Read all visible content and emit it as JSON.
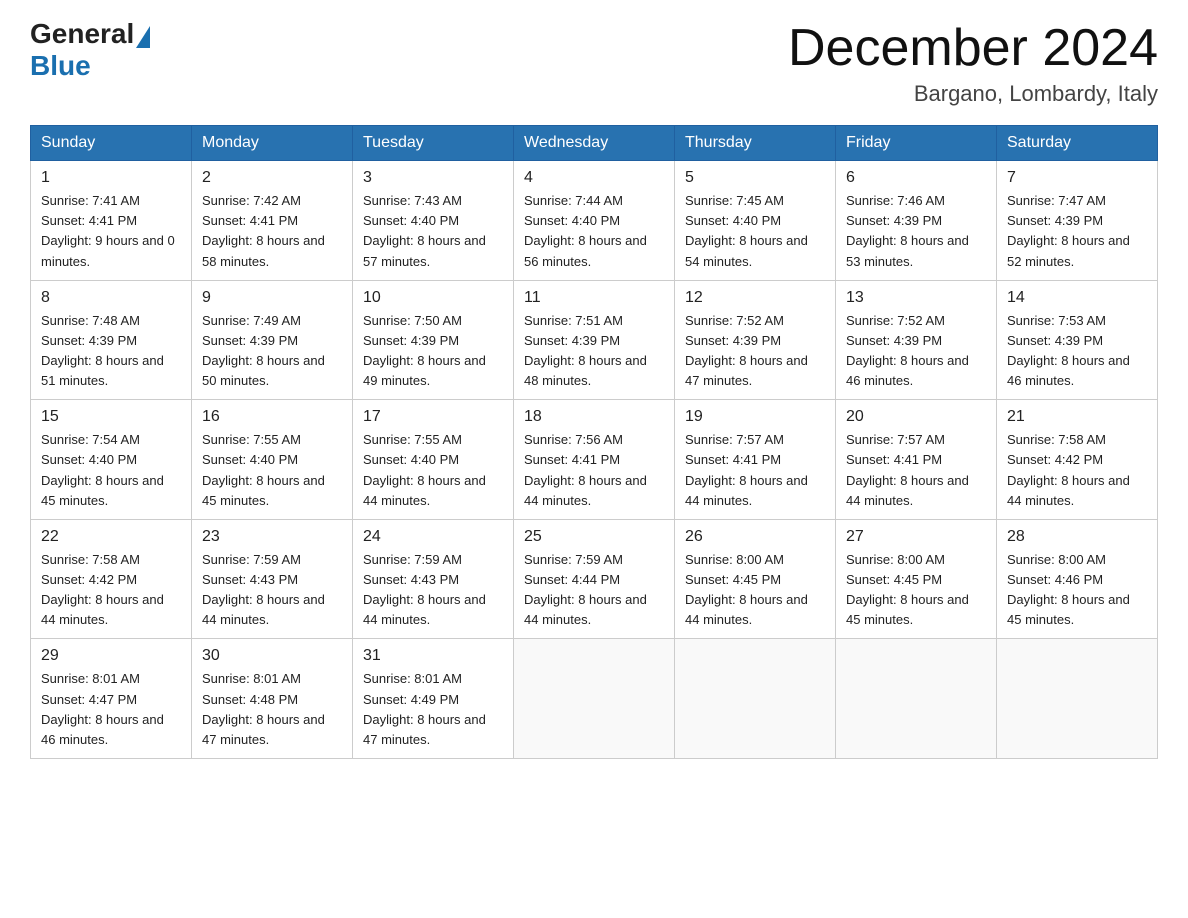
{
  "header": {
    "logo_general": "General",
    "logo_blue": "Blue",
    "month_title": "December 2024",
    "location": "Bargano, Lombardy, Italy"
  },
  "days_of_week": [
    "Sunday",
    "Monday",
    "Tuesday",
    "Wednesday",
    "Thursday",
    "Friday",
    "Saturday"
  ],
  "weeks": [
    [
      {
        "day": "1",
        "sunrise": "7:41 AM",
        "sunset": "4:41 PM",
        "daylight": "9 hours and 0 minutes."
      },
      {
        "day": "2",
        "sunrise": "7:42 AM",
        "sunset": "4:41 PM",
        "daylight": "8 hours and 58 minutes."
      },
      {
        "day": "3",
        "sunrise": "7:43 AM",
        "sunset": "4:40 PM",
        "daylight": "8 hours and 57 minutes."
      },
      {
        "day": "4",
        "sunrise": "7:44 AM",
        "sunset": "4:40 PM",
        "daylight": "8 hours and 56 minutes."
      },
      {
        "day": "5",
        "sunrise": "7:45 AM",
        "sunset": "4:40 PM",
        "daylight": "8 hours and 54 minutes."
      },
      {
        "day": "6",
        "sunrise": "7:46 AM",
        "sunset": "4:39 PM",
        "daylight": "8 hours and 53 minutes."
      },
      {
        "day": "7",
        "sunrise": "7:47 AM",
        "sunset": "4:39 PM",
        "daylight": "8 hours and 52 minutes."
      }
    ],
    [
      {
        "day": "8",
        "sunrise": "7:48 AM",
        "sunset": "4:39 PM",
        "daylight": "8 hours and 51 minutes."
      },
      {
        "day": "9",
        "sunrise": "7:49 AM",
        "sunset": "4:39 PM",
        "daylight": "8 hours and 50 minutes."
      },
      {
        "day": "10",
        "sunrise": "7:50 AM",
        "sunset": "4:39 PM",
        "daylight": "8 hours and 49 minutes."
      },
      {
        "day": "11",
        "sunrise": "7:51 AM",
        "sunset": "4:39 PM",
        "daylight": "8 hours and 48 minutes."
      },
      {
        "day": "12",
        "sunrise": "7:52 AM",
        "sunset": "4:39 PM",
        "daylight": "8 hours and 47 minutes."
      },
      {
        "day": "13",
        "sunrise": "7:52 AM",
        "sunset": "4:39 PM",
        "daylight": "8 hours and 46 minutes."
      },
      {
        "day": "14",
        "sunrise": "7:53 AM",
        "sunset": "4:39 PM",
        "daylight": "8 hours and 46 minutes."
      }
    ],
    [
      {
        "day": "15",
        "sunrise": "7:54 AM",
        "sunset": "4:40 PM",
        "daylight": "8 hours and 45 minutes."
      },
      {
        "day": "16",
        "sunrise": "7:55 AM",
        "sunset": "4:40 PM",
        "daylight": "8 hours and 45 minutes."
      },
      {
        "day": "17",
        "sunrise": "7:55 AM",
        "sunset": "4:40 PM",
        "daylight": "8 hours and 44 minutes."
      },
      {
        "day": "18",
        "sunrise": "7:56 AM",
        "sunset": "4:41 PM",
        "daylight": "8 hours and 44 minutes."
      },
      {
        "day": "19",
        "sunrise": "7:57 AM",
        "sunset": "4:41 PM",
        "daylight": "8 hours and 44 minutes."
      },
      {
        "day": "20",
        "sunrise": "7:57 AM",
        "sunset": "4:41 PM",
        "daylight": "8 hours and 44 minutes."
      },
      {
        "day": "21",
        "sunrise": "7:58 AM",
        "sunset": "4:42 PM",
        "daylight": "8 hours and 44 minutes."
      }
    ],
    [
      {
        "day": "22",
        "sunrise": "7:58 AM",
        "sunset": "4:42 PM",
        "daylight": "8 hours and 44 minutes."
      },
      {
        "day": "23",
        "sunrise": "7:59 AM",
        "sunset": "4:43 PM",
        "daylight": "8 hours and 44 minutes."
      },
      {
        "day": "24",
        "sunrise": "7:59 AM",
        "sunset": "4:43 PM",
        "daylight": "8 hours and 44 minutes."
      },
      {
        "day": "25",
        "sunrise": "7:59 AM",
        "sunset": "4:44 PM",
        "daylight": "8 hours and 44 minutes."
      },
      {
        "day": "26",
        "sunrise": "8:00 AM",
        "sunset": "4:45 PM",
        "daylight": "8 hours and 44 minutes."
      },
      {
        "day": "27",
        "sunrise": "8:00 AM",
        "sunset": "4:45 PM",
        "daylight": "8 hours and 45 minutes."
      },
      {
        "day": "28",
        "sunrise": "8:00 AM",
        "sunset": "4:46 PM",
        "daylight": "8 hours and 45 minutes."
      }
    ],
    [
      {
        "day": "29",
        "sunrise": "8:01 AM",
        "sunset": "4:47 PM",
        "daylight": "8 hours and 46 minutes."
      },
      {
        "day": "30",
        "sunrise": "8:01 AM",
        "sunset": "4:48 PM",
        "daylight": "8 hours and 47 minutes."
      },
      {
        "day": "31",
        "sunrise": "8:01 AM",
        "sunset": "4:49 PM",
        "daylight": "8 hours and 47 minutes."
      },
      null,
      null,
      null,
      null
    ]
  ]
}
